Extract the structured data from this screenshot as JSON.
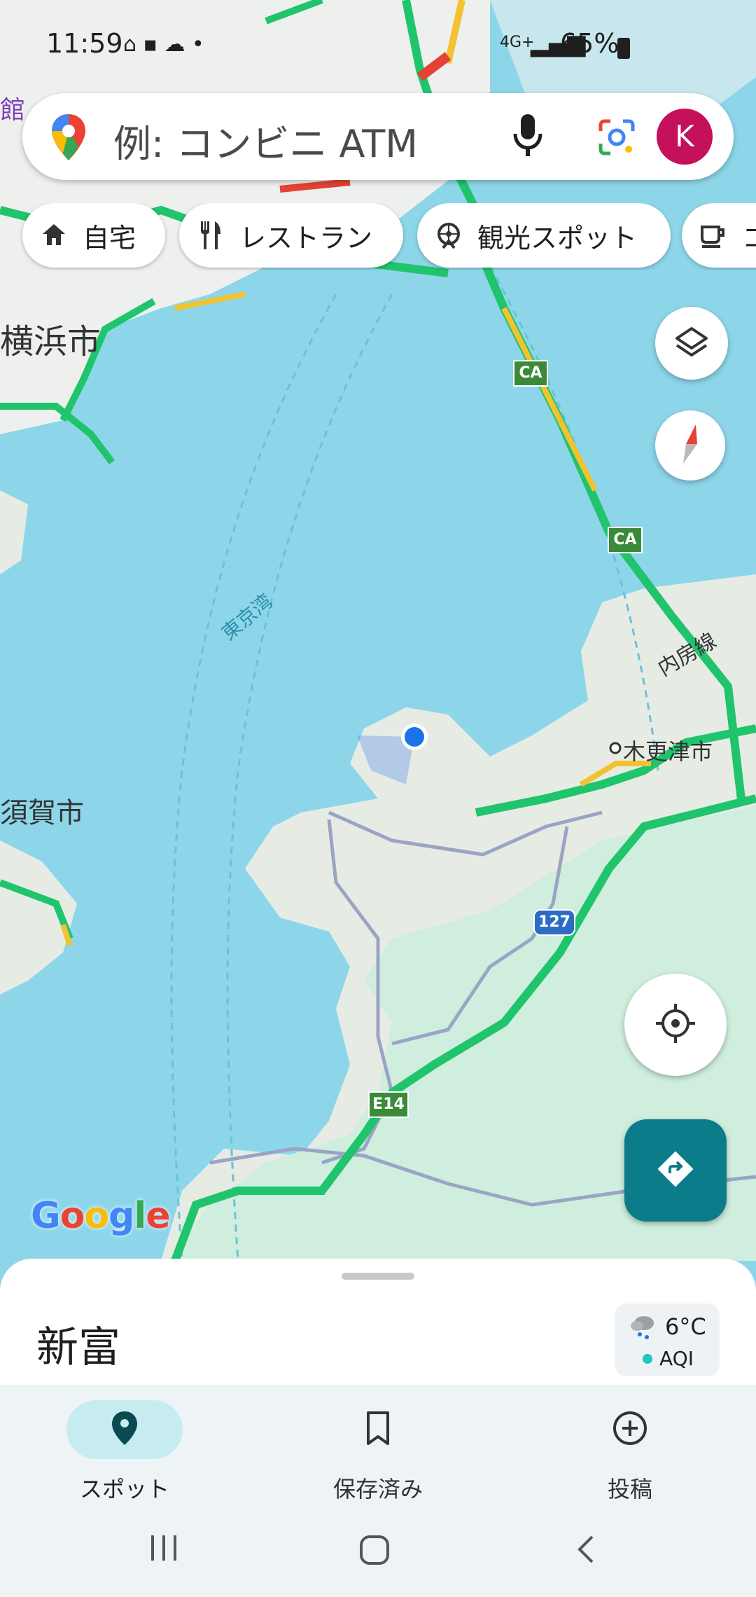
{
  "status_bar": {
    "time": "11:59",
    "battery": "65%",
    "network": "4G+"
  },
  "search": {
    "placeholder": "例: コンビニ ATM",
    "avatar_letter": "K"
  },
  "chips": [
    {
      "label": "自宅",
      "icon": "home-icon"
    },
    {
      "label": "レストラン",
      "icon": "restaurant-icon"
    },
    {
      "label": "観光スポット",
      "icon": "attraction-icon"
    },
    {
      "label": "コ",
      "icon": "coffee-icon"
    }
  ],
  "map": {
    "labels": {
      "yokohama": "横浜市",
      "tokyo_bay": "東京湾",
      "kisarazu": "木更津市",
      "yokosuka": "須賀市",
      "uchibo_line": "内房線",
      "kan": "館"
    },
    "road_shields": [
      "CA",
      "CA",
      "127",
      "E14"
    ],
    "google_logo": "Google"
  },
  "sheet": {
    "place_title": "新富",
    "weather_temp": "6°C",
    "weather_aqi": "AQI"
  },
  "nav": {
    "items": [
      {
        "label": "スポット",
        "icon": "explore-pin-icon",
        "active": true
      },
      {
        "label": "保存済み",
        "icon": "bookmark-icon",
        "active": false
      },
      {
        "label": "投稿",
        "icon": "add-circle-icon",
        "active": false
      }
    ]
  },
  "colors": {
    "water": "#8dd6ea",
    "land": "#f5f5f2",
    "green_land": "#cfeedd",
    "highway": "#1fc46c",
    "traffic_yellow": "#f2c230",
    "traffic_red": "#e34234",
    "accent_teal": "#0b7d8a",
    "avatar": "#c5105a"
  }
}
